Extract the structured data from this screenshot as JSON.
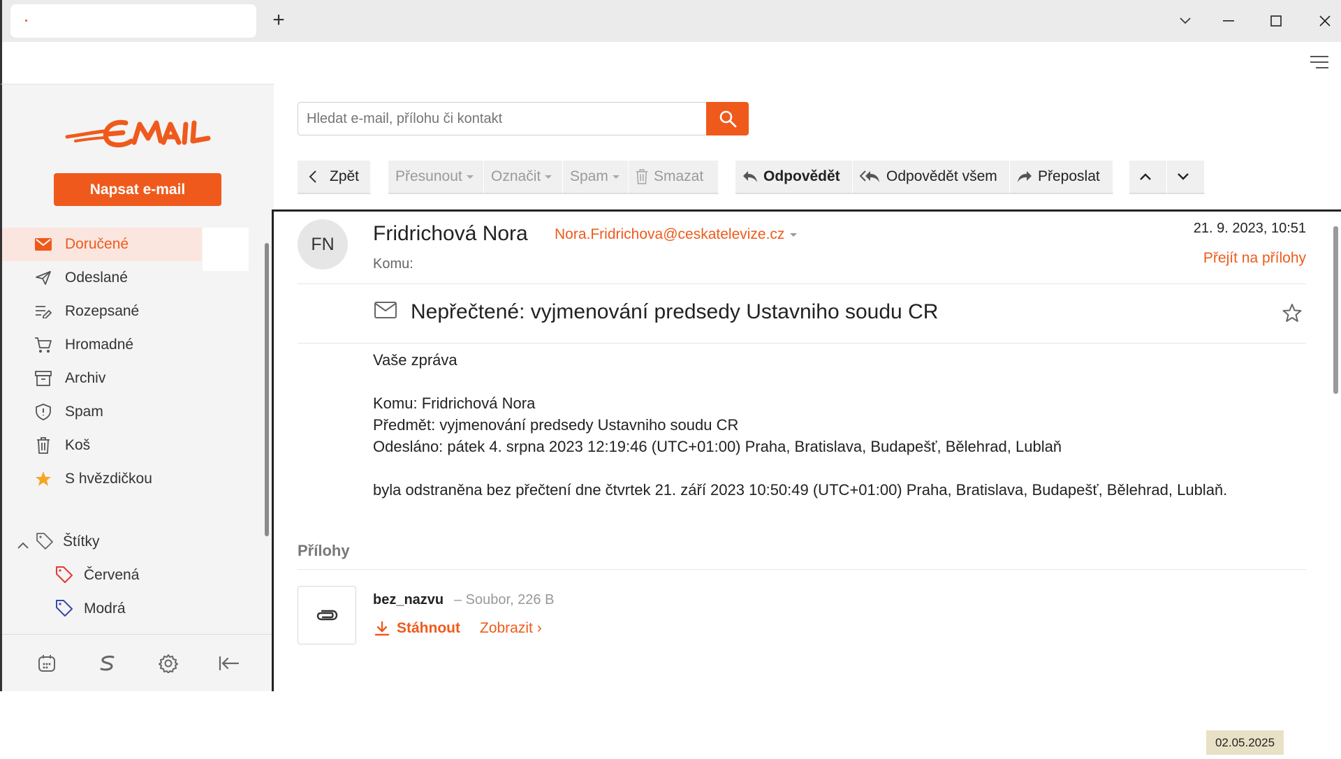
{
  "browser": {
    "tab_title": ""
  },
  "search": {
    "placeholder": "Hledat e-mail, přílohu či kontakt"
  },
  "sidebar": {
    "compose_label": "Napsat e-mail",
    "items": [
      {
        "label": "Doručené",
        "icon": "mail-icon",
        "active": true
      },
      {
        "label": "Odeslané",
        "icon": "send-icon"
      },
      {
        "label": "Rozepsané",
        "icon": "draft-icon"
      },
      {
        "label": "Hromadné",
        "icon": "cart-icon"
      },
      {
        "label": "Archiv",
        "icon": "archive-icon"
      },
      {
        "label": "Spam",
        "icon": "shield-icon"
      },
      {
        "label": "Koš",
        "icon": "trash-icon"
      },
      {
        "label": "S hvězdičkou",
        "icon": "star-icon"
      }
    ],
    "tags_label": "Štítky",
    "tags": [
      {
        "label": "Červená",
        "color": "#e53935"
      },
      {
        "label": "Modrá",
        "color": "#3949ab"
      }
    ]
  },
  "toolbar": {
    "back": "Zpět",
    "move": "Přesunout",
    "mark": "Označit",
    "spam": "Spam",
    "delete": "Smazat",
    "reply": "Odpovědět",
    "reply_all": "Odpovědět všem",
    "forward": "Přeposlat"
  },
  "message": {
    "initials": "FN",
    "sender_name": "Fridrichová Nora",
    "sender_email": "Nora.Fridrichova@ceskatelevize.cz",
    "to_label": "Komu:",
    "date": "21. 9. 2023, 10:51",
    "goto_attachments": "Přejít na přílohy",
    "subject": "Nepřečtené: vyjmenování predsedy Ustavniho soudu CR",
    "body": {
      "line1": "Vaše zpráva",
      "line2": "Komu: Fridrichová Nora",
      "line3": "Předmět: vyjmenování predsedy Ustavniho soudu CR",
      "line4": "Odesláno: pátek 4. srpna 2023 12:19:46 (UTC+01:00) Praha, Bratislava, Budapešť, Bělehrad, Lublaň",
      "line5": "byla odstraněna bez přečtení dne čtvrtek 21. září 2023 10:50:49 (UTC+01:00) Praha, Bratislava, Budapešť, Bělehrad, Lublaň."
    }
  },
  "attachments": {
    "heading": "Přílohy",
    "items": [
      {
        "name": "bez_nazvu",
        "meta": "– Soubor, 226 B",
        "download": "Stáhnout",
        "view": "Zobrazit ›"
      }
    ]
  },
  "taskbar": {
    "date": "02.05.2025"
  },
  "colors": {
    "accent": "#ef5a1c"
  }
}
